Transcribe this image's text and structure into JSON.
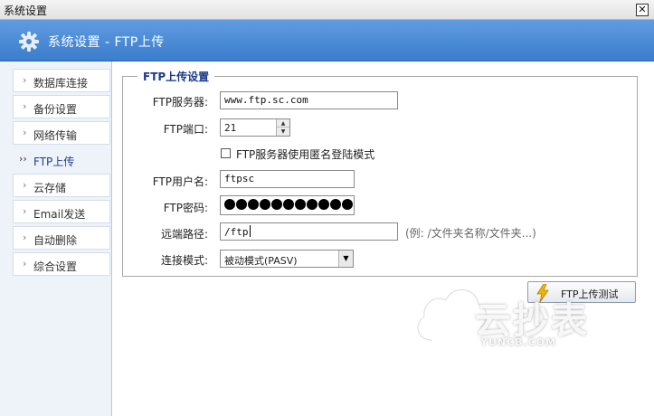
{
  "window": {
    "title": "系统设置",
    "close_glyph": "✕"
  },
  "header": {
    "title": "系统设置 - FTP上传",
    "icon": "gear-icon"
  },
  "sidebar": {
    "items": [
      {
        "label": "数据库连接",
        "chevron": "›",
        "active": false
      },
      {
        "label": "备份设置",
        "chevron": "›",
        "active": false
      },
      {
        "label": "网络传输",
        "chevron": "›",
        "active": false
      },
      {
        "label": "FTP上传",
        "chevron": "››",
        "active": true
      },
      {
        "label": "云存储",
        "chevron": "›",
        "active": false
      },
      {
        "label": "Email发送",
        "chevron": "›",
        "active": false
      },
      {
        "label": "自动删除",
        "chevron": "›",
        "active": false
      },
      {
        "label": "综合设置",
        "chevron": "›",
        "active": false
      }
    ]
  },
  "ftp": {
    "group_title": "FTP上传设置",
    "server_label": "FTP服务器:",
    "server_value": "www.ftp.sc.com",
    "port_label": "FTP端口:",
    "port_value": "21",
    "anon_label": "FTP服务器使用匿名登陆模式",
    "anon_checked": false,
    "user_label": "FTP用户名:",
    "user_value": "ftpsc",
    "password_label": "FTP密码:",
    "password_length": 11,
    "path_label": "远端路径:",
    "path_value": "/ftp",
    "path_hint": "(例: /文件夹名称/文件夹...)",
    "mode_label": "连接模式:",
    "mode_value": "被动模式(PASV)",
    "test_button": "FTP上传测试"
  },
  "watermark": {
    "text": "云抄表",
    "sub": "YUNCB.COM"
  },
  "colors": {
    "header": "#3b7dcd",
    "sidebar_bg": "#eef3fa",
    "legend": "#1a3a8e"
  }
}
